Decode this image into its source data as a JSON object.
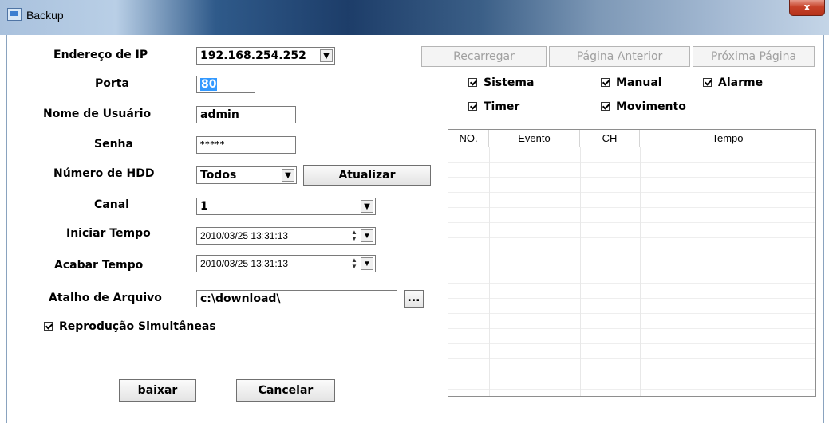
{
  "window": {
    "title": "Backup",
    "close_label": "x"
  },
  "form": {
    "ip_label": "Endereço de IP",
    "ip_value": "192.168.254.252",
    "port_label": "Porta",
    "port_value": "80",
    "user_label": "Nome de Usuário",
    "user_value": "admin",
    "password_label": "Senha",
    "password_value": "*****",
    "hdd_label": "Número de HDD",
    "hdd_value": "Todos",
    "refresh_label": "Atualizar",
    "channel_label": "Canal",
    "channel_value": "1",
    "start_label": "Iniciar Tempo",
    "start_value": "2010/03/25 13:31:13",
    "end_label": "Acabar Tempo",
    "end_value": "2010/03/25 13:31:13",
    "path_label": "Atalho de Arquivo",
    "path_value": "c:\\download\\",
    "browse_label": "...",
    "simultaneous_label": "Reprodução Simultâneas"
  },
  "toolbar": {
    "reload_label": "Recarregar",
    "prev_label": "Página Anterior",
    "next_label": "Próxima Página"
  },
  "filters": {
    "sistema": "Sistema",
    "manual": "Manual",
    "alarme": "Alarme",
    "timer": "Timer",
    "movimento": "Movimento"
  },
  "table": {
    "headers": [
      "NO.",
      "Evento",
      "CH",
      "Tempo"
    ]
  },
  "actions": {
    "download_label": "baixar",
    "cancel_label": "Cancelar"
  }
}
